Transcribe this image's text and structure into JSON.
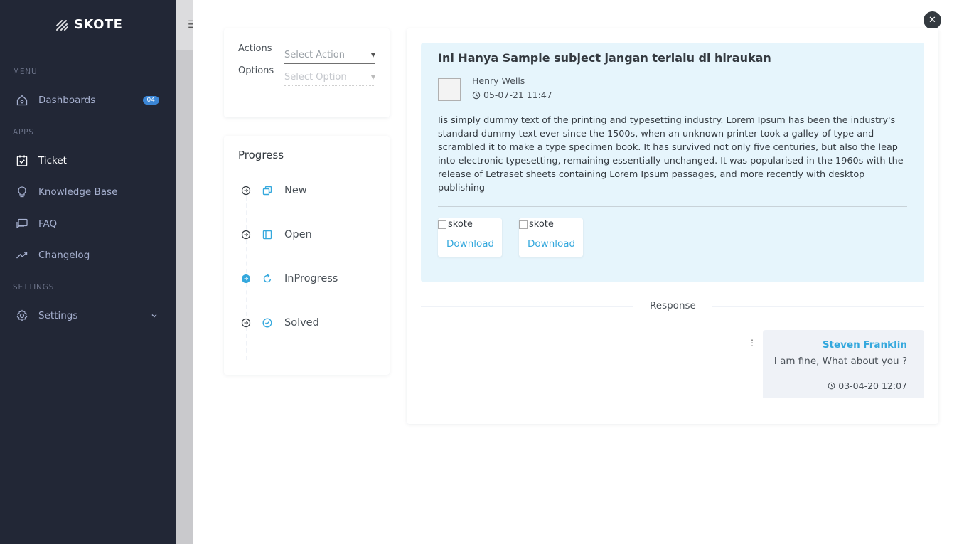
{
  "sidebar": {
    "logo_text": "SKOTE",
    "sections": {
      "menu": "MENU",
      "apps": "APPS",
      "settings": "SETTINGS"
    },
    "items": [
      {
        "label": "Dashboards",
        "icon": "home-icon",
        "badge": "04"
      },
      {
        "label": "Ticket",
        "icon": "calendar-check-icon",
        "active": true
      },
      {
        "label": "Knowledge Base",
        "icon": "lightbulb-icon"
      },
      {
        "label": "FAQ",
        "icon": "chat-icon"
      },
      {
        "label": "Changelog",
        "icon": "trend-icon"
      },
      {
        "label": "Settings",
        "icon": "gear-icon"
      }
    ]
  },
  "actions": {
    "actions_label": "Actions",
    "options_label": "Options",
    "action_placeholder": "Select Action",
    "option_placeholder": "Select Option"
  },
  "progress": {
    "title": "Progress",
    "steps": [
      {
        "label": "New",
        "icon": "copy-icon",
        "current": false
      },
      {
        "label": "Open",
        "icon": "panel-icon",
        "current": false
      },
      {
        "label": "InProgress",
        "icon": "refresh-icon",
        "current": true
      },
      {
        "label": "Solved",
        "icon": "check-circle-icon",
        "current": false
      }
    ]
  },
  "ticket": {
    "subject": "Ini Hanya Sample subject jangan terlalu di hiraukan",
    "sender": "Henry Wells",
    "time": "05-07-21 11:47",
    "body": "Iis simply dummy text of the printing and typesetting industry. Lorem Ipsum has been the industry's standard dummy text ever since the 1500s, when an unknown printer took a galley of type and scrambled it to make a type specimen book. It has survived not only five centuries, but also the leap into electronic typesetting, remaining essentially unchanged. It was popularised in the 1960s with the release of Letraset sheets containing Lorem Ipsum passages, and more recently with desktop publishing",
    "attachments": [
      {
        "alt": "skote",
        "action": "Download"
      },
      {
        "alt": "skote",
        "action": "Download"
      }
    ]
  },
  "response": {
    "label": "Response",
    "reply": {
      "name": "Steven Franklin",
      "text": "I am fine, What about you ?",
      "time": "03-04-20 12:07"
    }
  },
  "colors": {
    "sidebar_bg": "#222736",
    "accent": "#34a8dd",
    "message_bg": "#e6f5fc",
    "reply_bg": "#eff2f7"
  }
}
